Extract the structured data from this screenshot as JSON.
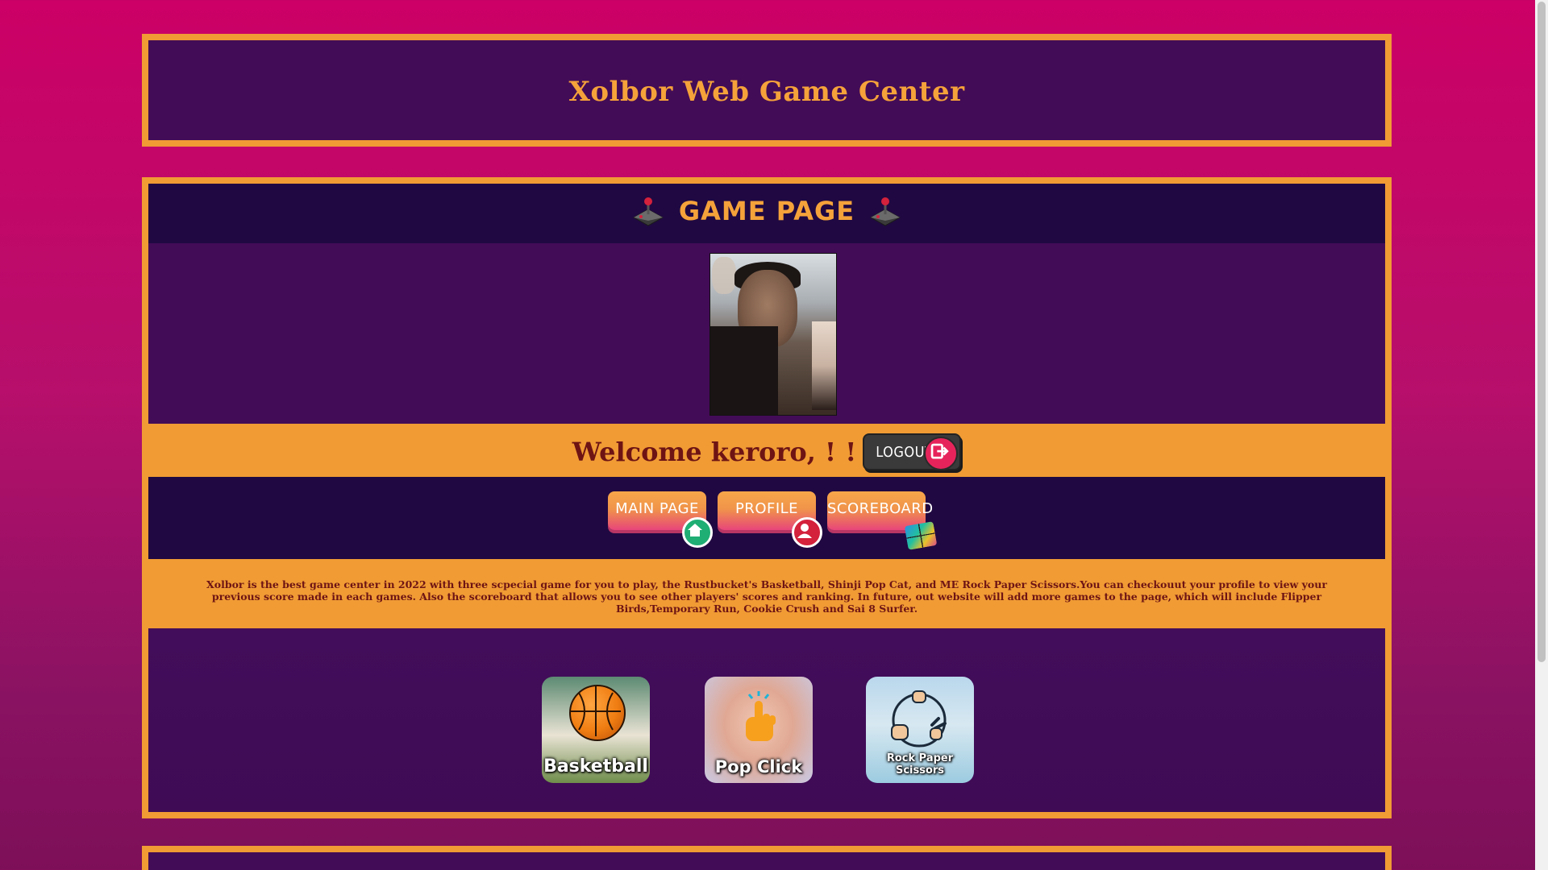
{
  "header": {
    "site_title": "Xolbor Web Game Center"
  },
  "game_page": {
    "title": "GAME PAGE",
    "welcome_text": "Welcome keroro, ! !",
    "logout_label": "LOGOUT",
    "nav": {
      "main_page": "MAIN PAGE",
      "profile": "PROFILE",
      "scoreboard": "SCOREBOARD"
    },
    "description": "Xolbor is the best game center in 2022 with three scpecial game for you to play, the Rustbucket's Basketball, Shinji Pop Cat, and ME Rock Paper Scissors.You can checkouut your profile to view your previous score made in each games. Also the scoreboard that allows you to see other players' scores and ranking. In future, out website will add more games to the page, which will include Flipper Birds,Temporary Run, Cookie Crush and Sai 8 Surfer.",
    "games": [
      {
        "label": "Basketball",
        "icon": "basketball-icon"
      },
      {
        "label": "Pop Click",
        "icon": "pointing-hand-icon"
      },
      {
        "label": "Rock Paper Scissors",
        "icon": "rock-paper-scissors-icon"
      }
    ]
  },
  "colors": {
    "accent_orange": "#f09b34",
    "panel_purple": "#430c57",
    "bar_navy": "#200942",
    "text_maroon": "#6e1414",
    "background_pink": "#cc0066"
  },
  "icons": {
    "title_icons": "joystick-icon",
    "logout_icon": "logout-icon",
    "main_page_badge": "home-icon",
    "profile_badge": "user-icon",
    "scoreboard_badge": "grid-icon"
  }
}
